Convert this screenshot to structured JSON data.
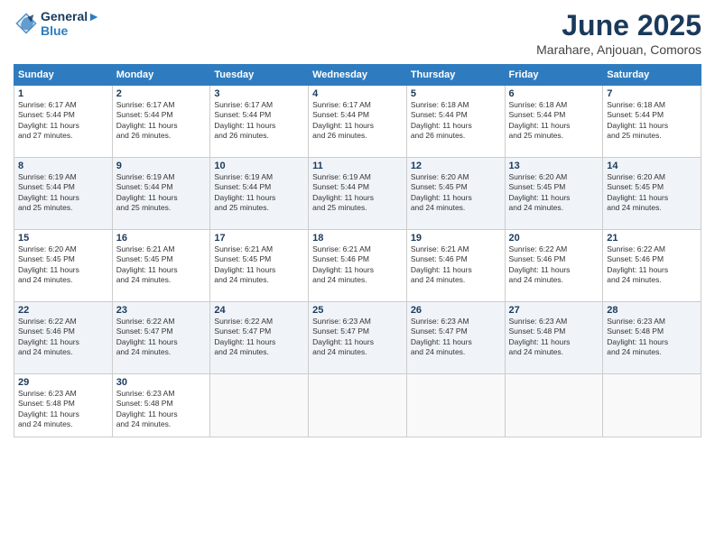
{
  "header": {
    "logo_line1": "General",
    "logo_line2": "Blue",
    "month": "June 2025",
    "location": "Marahare, Anjouan, Comoros"
  },
  "days_of_week": [
    "Sunday",
    "Monday",
    "Tuesday",
    "Wednesday",
    "Thursday",
    "Friday",
    "Saturday"
  ],
  "weeks": [
    [
      {
        "day": "1",
        "info": "Sunrise: 6:17 AM\nSunset: 5:44 PM\nDaylight: 11 hours\nand 27 minutes."
      },
      {
        "day": "2",
        "info": "Sunrise: 6:17 AM\nSunset: 5:44 PM\nDaylight: 11 hours\nand 26 minutes."
      },
      {
        "day": "3",
        "info": "Sunrise: 6:17 AM\nSunset: 5:44 PM\nDaylight: 11 hours\nand 26 minutes."
      },
      {
        "day": "4",
        "info": "Sunrise: 6:17 AM\nSunset: 5:44 PM\nDaylight: 11 hours\nand 26 minutes."
      },
      {
        "day": "5",
        "info": "Sunrise: 6:18 AM\nSunset: 5:44 PM\nDaylight: 11 hours\nand 26 minutes."
      },
      {
        "day": "6",
        "info": "Sunrise: 6:18 AM\nSunset: 5:44 PM\nDaylight: 11 hours\nand 25 minutes."
      },
      {
        "day": "7",
        "info": "Sunrise: 6:18 AM\nSunset: 5:44 PM\nDaylight: 11 hours\nand 25 minutes."
      }
    ],
    [
      {
        "day": "8",
        "info": "Sunrise: 6:19 AM\nSunset: 5:44 PM\nDaylight: 11 hours\nand 25 minutes."
      },
      {
        "day": "9",
        "info": "Sunrise: 6:19 AM\nSunset: 5:44 PM\nDaylight: 11 hours\nand 25 minutes."
      },
      {
        "day": "10",
        "info": "Sunrise: 6:19 AM\nSunset: 5:44 PM\nDaylight: 11 hours\nand 25 minutes."
      },
      {
        "day": "11",
        "info": "Sunrise: 6:19 AM\nSunset: 5:44 PM\nDaylight: 11 hours\nand 25 minutes."
      },
      {
        "day": "12",
        "info": "Sunrise: 6:20 AM\nSunset: 5:45 PM\nDaylight: 11 hours\nand 24 minutes."
      },
      {
        "day": "13",
        "info": "Sunrise: 6:20 AM\nSunset: 5:45 PM\nDaylight: 11 hours\nand 24 minutes."
      },
      {
        "day": "14",
        "info": "Sunrise: 6:20 AM\nSunset: 5:45 PM\nDaylight: 11 hours\nand 24 minutes."
      }
    ],
    [
      {
        "day": "15",
        "info": "Sunrise: 6:20 AM\nSunset: 5:45 PM\nDaylight: 11 hours\nand 24 minutes."
      },
      {
        "day": "16",
        "info": "Sunrise: 6:21 AM\nSunset: 5:45 PM\nDaylight: 11 hours\nand 24 minutes."
      },
      {
        "day": "17",
        "info": "Sunrise: 6:21 AM\nSunset: 5:45 PM\nDaylight: 11 hours\nand 24 minutes."
      },
      {
        "day": "18",
        "info": "Sunrise: 6:21 AM\nSunset: 5:46 PM\nDaylight: 11 hours\nand 24 minutes."
      },
      {
        "day": "19",
        "info": "Sunrise: 6:21 AM\nSunset: 5:46 PM\nDaylight: 11 hours\nand 24 minutes."
      },
      {
        "day": "20",
        "info": "Sunrise: 6:22 AM\nSunset: 5:46 PM\nDaylight: 11 hours\nand 24 minutes."
      },
      {
        "day": "21",
        "info": "Sunrise: 6:22 AM\nSunset: 5:46 PM\nDaylight: 11 hours\nand 24 minutes."
      }
    ],
    [
      {
        "day": "22",
        "info": "Sunrise: 6:22 AM\nSunset: 5:46 PM\nDaylight: 11 hours\nand 24 minutes."
      },
      {
        "day": "23",
        "info": "Sunrise: 6:22 AM\nSunset: 5:47 PM\nDaylight: 11 hours\nand 24 minutes."
      },
      {
        "day": "24",
        "info": "Sunrise: 6:22 AM\nSunset: 5:47 PM\nDaylight: 11 hours\nand 24 minutes."
      },
      {
        "day": "25",
        "info": "Sunrise: 6:23 AM\nSunset: 5:47 PM\nDaylight: 11 hours\nand 24 minutes."
      },
      {
        "day": "26",
        "info": "Sunrise: 6:23 AM\nSunset: 5:47 PM\nDaylight: 11 hours\nand 24 minutes."
      },
      {
        "day": "27",
        "info": "Sunrise: 6:23 AM\nSunset: 5:48 PM\nDaylight: 11 hours\nand 24 minutes."
      },
      {
        "day": "28",
        "info": "Sunrise: 6:23 AM\nSunset: 5:48 PM\nDaylight: 11 hours\nand 24 minutes."
      }
    ],
    [
      {
        "day": "29",
        "info": "Sunrise: 6:23 AM\nSunset: 5:48 PM\nDaylight: 11 hours\nand 24 minutes."
      },
      {
        "day": "30",
        "info": "Sunrise: 6:23 AM\nSunset: 5:48 PM\nDaylight: 11 hours\nand 24 minutes."
      },
      {
        "day": "",
        "info": ""
      },
      {
        "day": "",
        "info": ""
      },
      {
        "day": "",
        "info": ""
      },
      {
        "day": "",
        "info": ""
      },
      {
        "day": "",
        "info": ""
      }
    ]
  ]
}
